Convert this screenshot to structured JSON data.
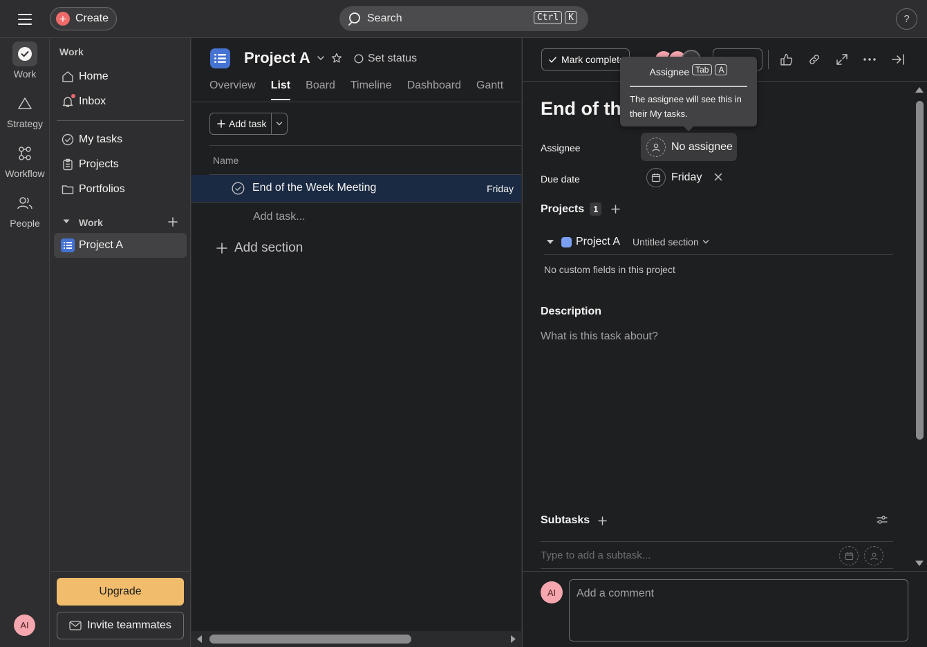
{
  "topbar": {
    "create_label": "Create",
    "search_placeholder": "Search",
    "search_keys": [
      "Ctrl",
      "K"
    ],
    "help_label": "?"
  },
  "rail": {
    "items": [
      {
        "label": "Work",
        "icon": "check-circle-icon"
      },
      {
        "label": "Strategy",
        "icon": "triangle-icon"
      },
      {
        "label": "Workflow",
        "icon": "workflow-icon"
      },
      {
        "label": "People",
        "icon": "people-icon"
      }
    ],
    "avatar_initials": "AI"
  },
  "sidebar": {
    "heading": "Work",
    "nav": [
      {
        "label": "Home",
        "icon": "home-icon"
      },
      {
        "label": "Inbox",
        "icon": "bell-icon",
        "unread": true
      }
    ],
    "work_nav": [
      {
        "label": "My tasks",
        "icon": "check-circle-icon"
      },
      {
        "label": "Projects",
        "icon": "clipboard-icon"
      },
      {
        "label": "Portfolios",
        "icon": "folder-icon"
      }
    ],
    "section_label": "Work",
    "projects": [
      {
        "label": "Project A",
        "color": "#4573d2"
      }
    ],
    "upgrade_label": "Upgrade",
    "invite_label": "Invite teammates"
  },
  "main": {
    "project_title": "Project A",
    "set_status_label": "Set status",
    "tabs": [
      {
        "label": "Overview",
        "active": false
      },
      {
        "label": "List",
        "active": true
      },
      {
        "label": "Board",
        "active": false
      },
      {
        "label": "Timeline",
        "active": false
      },
      {
        "label": "Dashboard",
        "active": false
      },
      {
        "label": "Gantt",
        "active": false
      }
    ],
    "add_task_label": "Add task",
    "column_name": "Name",
    "tasks": [
      {
        "name": "End of the Week Meeting",
        "due": "Friday"
      }
    ],
    "add_task_inline": "Add task...",
    "add_section_label": "Add section"
  },
  "panel": {
    "mark_complete_label": "Mark complete",
    "task_title": "End of the",
    "assignee_label": "Assignee",
    "assignee_value": "No assignee",
    "due_label": "Due date",
    "due_value": "Friday",
    "projects_label": "Projects",
    "projects_count": "1",
    "project_name": "Project A",
    "section_name": "Untitled section",
    "no_custom_fields": "No custom fields in this project",
    "description_label": "Description",
    "description_placeholder": "What is this task about?",
    "subtasks_label": "Subtasks",
    "subtask_placeholder": "Type to add a subtask...",
    "comment_avatar": "AI",
    "comment_placeholder": "Add a comment"
  },
  "tooltip": {
    "title": "Assignee",
    "keys": [
      "Tab",
      "A"
    ],
    "body": "The assignee will see this in their My tasks."
  },
  "colors": {
    "accent_create": "#f06a6a",
    "upgrade": "#f1bd6c",
    "project": "#4573d2",
    "selected_row": "#1b2a43"
  }
}
